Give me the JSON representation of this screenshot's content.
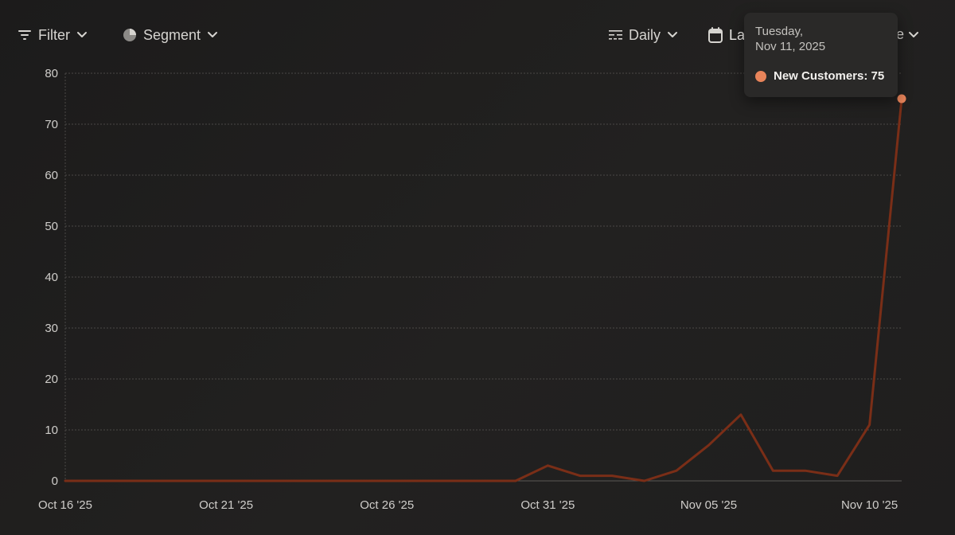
{
  "toolbar": {
    "filter_label": "Filter",
    "segment_label": "Segment",
    "interval_label": "Daily",
    "range_label_visible": "La",
    "range_label_tail": "e"
  },
  "tooltip": {
    "weekday": "Tuesday,",
    "date": "Nov 11, 2025",
    "series_label": "New Customers: 75"
  },
  "colors": {
    "line": "#7a2e17",
    "marker": "#e8845a",
    "grid": "#4a4846",
    "axis": "#5a5855"
  },
  "chart_data": {
    "type": "line",
    "x": [
      "2025-10-16",
      "2025-10-17",
      "2025-10-18",
      "2025-10-19",
      "2025-10-20",
      "2025-10-21",
      "2025-10-22",
      "2025-10-23",
      "2025-10-24",
      "2025-10-25",
      "2025-10-26",
      "2025-10-27",
      "2025-10-28",
      "2025-10-29",
      "2025-10-30",
      "2025-10-31",
      "2025-11-01",
      "2025-11-02",
      "2025-11-03",
      "2025-11-04",
      "2025-11-05",
      "2025-11-06",
      "2025-11-07",
      "2025-11-08",
      "2025-11-09",
      "2025-11-10",
      "2025-11-11"
    ],
    "series": [
      {
        "name": "New Customers",
        "values": [
          0,
          0,
          0,
          0,
          0,
          0,
          0,
          0,
          0,
          0,
          0,
          0,
          0,
          0,
          0,
          3,
          1,
          1,
          0,
          2,
          7,
          13,
          2,
          2,
          1,
          11,
          75
        ]
      }
    ],
    "x_tick_labels": [
      "Oct 16 '25",
      "Oct 21 '25",
      "Oct 26 '25",
      "Oct 31 '25",
      "Nov 05 '25",
      "Nov 10 '25"
    ],
    "y_tick_labels": [
      "0",
      "10",
      "20",
      "30",
      "40",
      "50",
      "60",
      "70",
      "80"
    ],
    "ylim": [
      0,
      80
    ],
    "grid": true,
    "highlighted_date": "2025-11-11"
  }
}
